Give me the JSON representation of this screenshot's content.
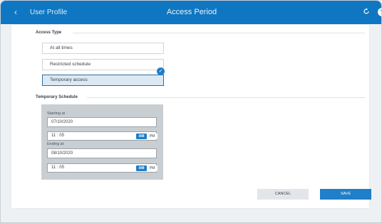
{
  "header": {
    "back_label": "User Profile",
    "title": "Access Period",
    "icons": {
      "back": "chevron-left-icon",
      "refresh": "refresh-icon",
      "help": "help-icon"
    }
  },
  "access_type": {
    "label": "Access Type",
    "options": [
      {
        "label": "At all times",
        "selected": false
      },
      {
        "label": "Restricted schedule",
        "selected": false
      },
      {
        "label": "Temporary access",
        "selected": true
      }
    ]
  },
  "temporary_schedule": {
    "label": "Temporary Schedule",
    "starting": {
      "label": "Starting at",
      "date": "07/10/2020",
      "time": "11 : 05",
      "am": "AM",
      "pm": "PM"
    },
    "ending": {
      "label": "Ending at",
      "date": "08/10/2020",
      "time": "11 : 05",
      "am": "AM",
      "pm": "PM"
    }
  },
  "actions": {
    "cancel": "CANCEL",
    "save": "SAVE"
  },
  "colors": {
    "header": "#0f77c1",
    "accent": "#1f7fc8",
    "selected_bg": "#dbe9f4"
  }
}
